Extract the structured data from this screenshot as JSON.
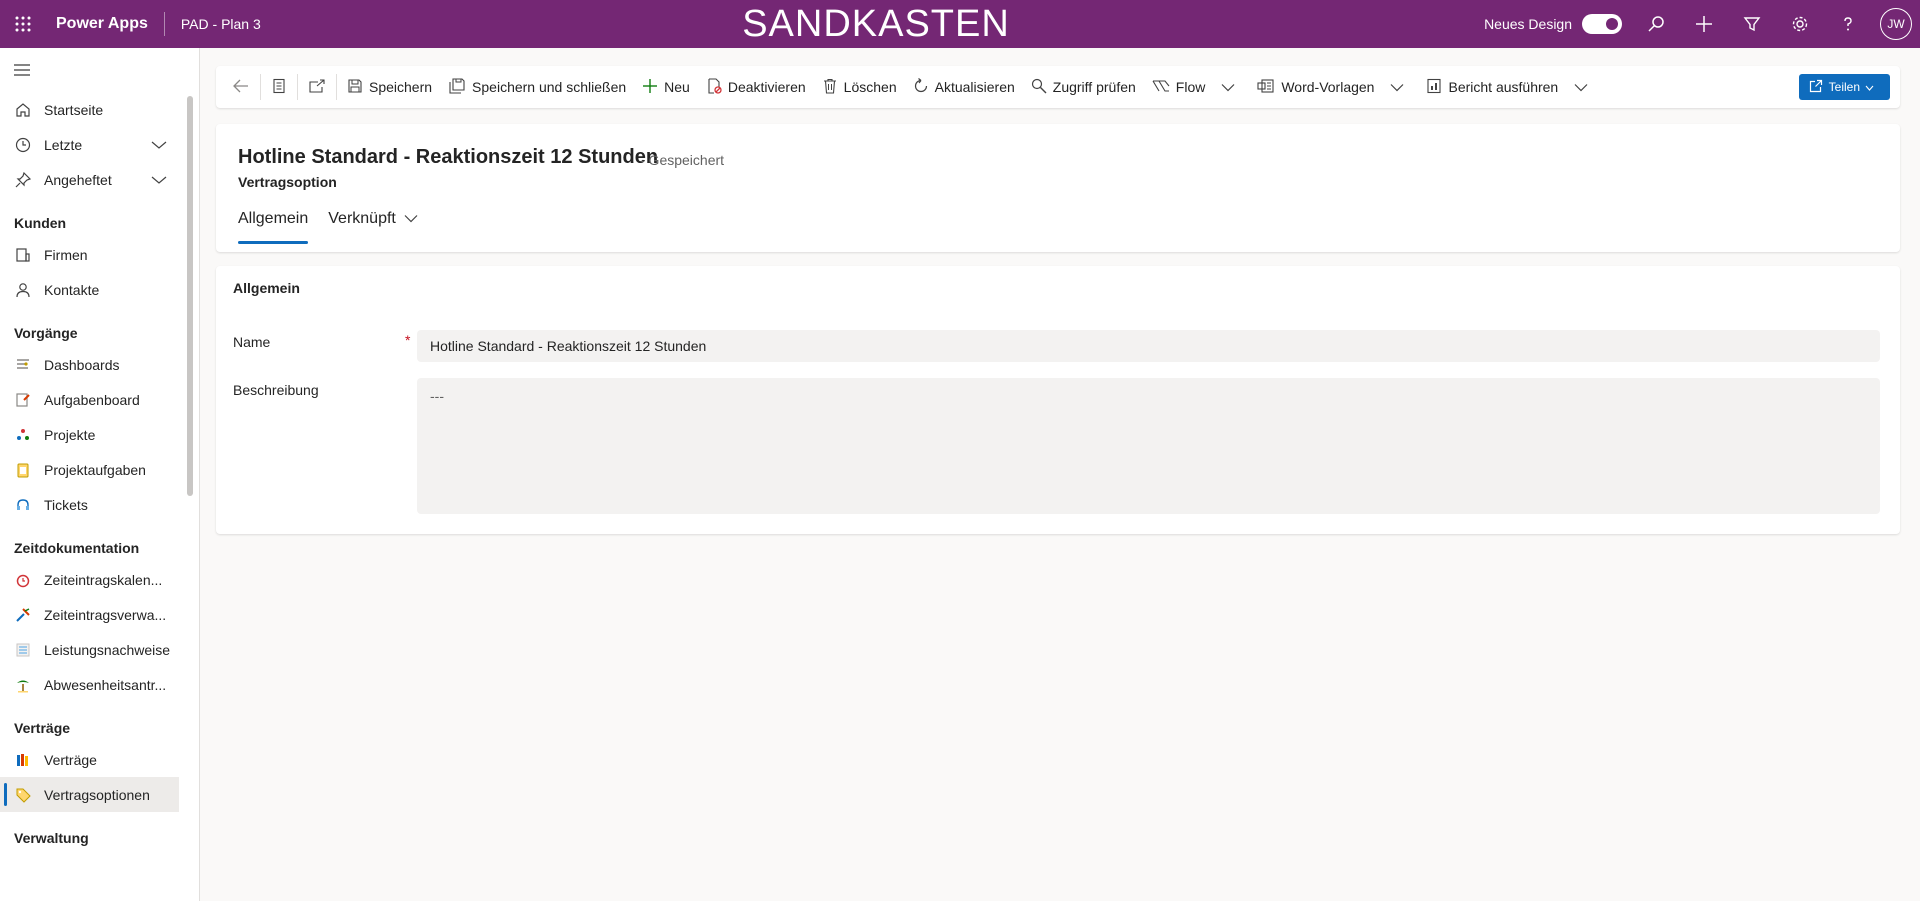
{
  "topbar": {
    "app_name": "Power Apps",
    "env_name": "PAD - Plan 3",
    "banner": "SANDKASTEN",
    "new_design_label": "Neues Design",
    "new_design_enabled": true,
    "avatar_initials": "JW",
    "background_color": "#742774"
  },
  "sidebar": {
    "top_items": [
      {
        "label": "Startseite",
        "icon": "home-icon"
      },
      {
        "label": "Letzte",
        "icon": "clock-icon"
      },
      {
        "label": "Angeheftet",
        "icon": "pin-icon"
      }
    ],
    "sections": [
      {
        "title": "Kunden",
        "items": [
          {
            "label": "Firmen",
            "icon": "building-icon"
          },
          {
            "label": "Kontakte",
            "icon": "person-icon"
          }
        ]
      },
      {
        "title": "Vorgänge",
        "items": [
          {
            "label": "Dashboards",
            "icon": "dashboard-icon"
          },
          {
            "label": "Aufgabenboard",
            "icon": "board-icon"
          },
          {
            "label": "Projekte",
            "icon": "project-icon"
          },
          {
            "label": "Projektaufgaben",
            "icon": "clipboard-icon"
          },
          {
            "label": "Tickets",
            "icon": "headset-icon"
          }
        ]
      },
      {
        "title": "Zeitdokumentation",
        "items": [
          {
            "label": "Zeiteintragskalen...",
            "icon": "alarm-icon"
          },
          {
            "label": "Zeiteintragsverwa...",
            "icon": "tools-icon"
          },
          {
            "label": "Leistungsnachweise",
            "icon": "list-icon"
          },
          {
            "label": "Abwesenheitsantr...",
            "icon": "palm-icon"
          }
        ]
      },
      {
        "title": "Verträge",
        "items": [
          {
            "label": "Verträge",
            "icon": "books-icon"
          },
          {
            "label": "Vertragsoptionen",
            "icon": "tag-icon",
            "active": true
          }
        ]
      },
      {
        "title": "Verwaltung",
        "items": []
      }
    ]
  },
  "commandbar": {
    "save": "Speichern",
    "save_close": "Speichern und schließen",
    "new": "Neu",
    "deactivate": "Deaktivieren",
    "delete": "Löschen",
    "refresh": "Aktualisieren",
    "check_access": "Zugriff prüfen",
    "flow": "Flow",
    "word_templates": "Word-Vorlagen",
    "run_report": "Bericht ausführen",
    "share": "Teilen"
  },
  "record": {
    "title": "Hotline Standard - Reaktionszeit 12 Stunden",
    "status": "- Gespeichert",
    "entity": "Vertragsoption",
    "tabs": [
      "Allgemein",
      "Verknüpft"
    ]
  },
  "form": {
    "section_title": "Allgemein",
    "name_label": "Name",
    "required_marker": "*",
    "name_value": "Hotline Standard - Reaktionszeit 12 Stunden",
    "description_label": "Beschreibung",
    "description_value": "---"
  }
}
